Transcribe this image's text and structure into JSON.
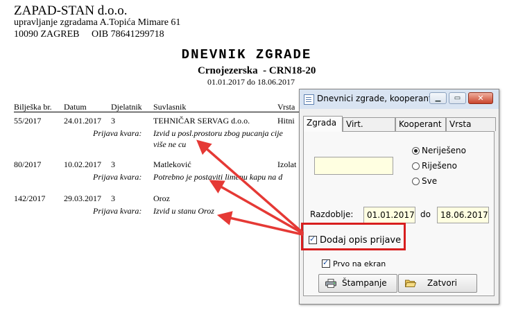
{
  "report": {
    "company": "ZAPAD-STAN d.o.o.",
    "address_line1": "upravljanje zgradama A.Topića Mimare 61",
    "address_line2": "10090 ZAGREB     OIB 78641299718",
    "title": "DNEVNIK ZGRADE",
    "subtitle": "Crnojezerska  - CRN18-20",
    "date_range": "01.01.2017 do 18.06.2017",
    "columns": [
      "Bilješka br.",
      "Datum",
      "Djelatnik",
      "Suvlasnik",
      "Vrsta"
    ],
    "rows": [
      {
        "note_no": "55/2017",
        "date": "24.01.2017",
        "worker": "3",
        "owner": "TEHNIČAR SERVAG d.o.o.",
        "type": "Hitni",
        "label": "Prijava kvara:",
        "desc_line1": "Izvid u posl.prostoru zbog pucanja cije",
        "desc_line2": "više ne cu"
      },
      {
        "note_no": "80/2017",
        "date": "10.02.2017",
        "worker": "3",
        "owner": "Matleković",
        "type": "Izolat",
        "label": "Prijava kvara:",
        "desc_line1": "Potrebno je postaviti limenu kapu na d"
      },
      {
        "note_no": "142/2017",
        "date": "29.03.2017",
        "worker": "3",
        "owner": "Oroz",
        "type": "",
        "label": "Prijava kvara:",
        "desc_line1": "Izvid u stanu Oroz"
      }
    ]
  },
  "window": {
    "title": "Dnevnici zgrade, kooperant...",
    "tabs": [
      "Zgrada",
      "Virt. zgrada",
      "Kooperant",
      "Vrsta rada"
    ],
    "active_tab": "Zgrada",
    "building_input": {
      "value": ""
    },
    "status_options": [
      "Neriješeno",
      "Riješeno",
      "Sve"
    ],
    "status_selected": "Neriješeno",
    "period_label": "Razdoblje:",
    "date_from": "01.01.2017",
    "date_to_label": "do",
    "date_to": "18.06.2017",
    "add_desc_label": "Dodaj opis prijave",
    "add_desc_checked": true,
    "screen_label": "Prvo na ekran",
    "screen_checked": true,
    "print_button": "Štampanje",
    "close_button": "Zatvori"
  },
  "colors": {
    "highlight": "#d81e1e",
    "arrow": "#e53935",
    "input_bg": "#ffffe1"
  }
}
